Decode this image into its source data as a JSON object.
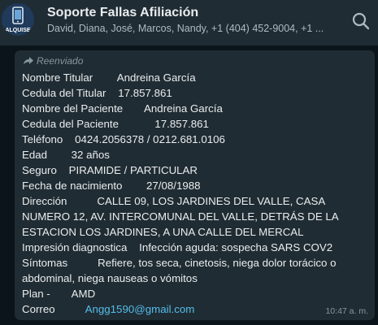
{
  "header": {
    "title": "Soporte Fallas Afiliación",
    "members": "David, Diana, José, Marcos, Nandy, +1 (404) 452-9004, +1 ...",
    "avatar_text": "ALQUISE",
    "avatar_icon": "phone-icon",
    "search_icon": "search-icon"
  },
  "message": {
    "forwarded_label": "Reenviado",
    "forward_icon": "forward-arrow-icon",
    "fields": {
      "titular_label": "Nombre Titular",
      "titular_value": "Andreina García",
      "cedula_titular_label": "Cedula del Titular",
      "cedula_titular_value": "17.857.861",
      "paciente_label": "Nombre del Paciente",
      "paciente_value": "Andreina García",
      "cedula_paciente_label": "Cedula del Paciente",
      "cedula_paciente_value": "17.857.861",
      "telefono_label": "Teléfono",
      "telefono_value": "0424.2056378 / 0212.681.0106",
      "edad_label": "Edad",
      "edad_value": "32 años",
      "seguro_label": "Seguro",
      "seguro_value": "PIRAMIDE / PARTICULAR",
      "nacimiento_label": "Fecha de nacimiento",
      "nacimiento_value": "27/08/1988",
      "direccion_label": "Dirección",
      "direccion_value": "CALLE 09, LOS JARDINES DEL VALLE, CASA NUMERO 12, AV. INTERCOMUNAL DEL VALLE, DETRÁS DE LA ESTACION LOS JARDINES, A UNA CALLE DEL MERCAL",
      "impresion_label": "Impresión diagnostica",
      "impresion_value": "Infección aguda: sospecha SARS COV2",
      "sintomas_label": "Síntomas",
      "sintomas_value": "Refiere, tos seca, cinetosis, niega dolor torácico o abdominal, niega nauseas o vómitos",
      "plan_label": "Plan -",
      "plan_value": "AMD",
      "correo_label": "Correo",
      "correo_value": "Angg1590@gmail.com"
    },
    "time": "10:47 a. m."
  },
  "colors": {
    "header_bg": "#202c33",
    "chat_bg": "#0b141a",
    "bubble_bg": "#202c33",
    "text": "#e9edef",
    "secondary": "#8696a0",
    "link": "#53bdeb"
  }
}
